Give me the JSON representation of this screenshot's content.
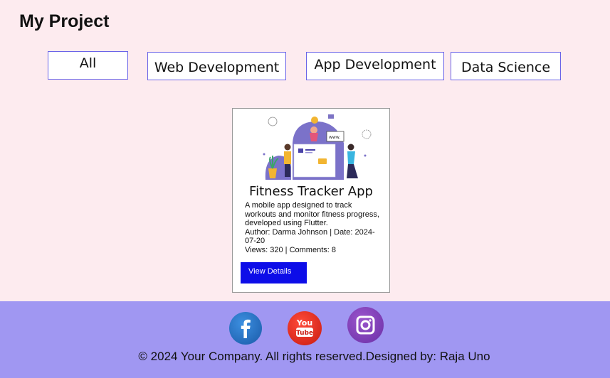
{
  "page": {
    "title": "My Project"
  },
  "filters": [
    {
      "label": "All"
    },
    {
      "label": "Web Development"
    },
    {
      "label": "App Development"
    },
    {
      "label": "Data Science"
    }
  ],
  "card": {
    "image_icon": "fitness-app-illustration",
    "title": "Fitness Tracker App",
    "description": "A mobile app designed to track workouts and monitor fitness progress, developed using Flutter.",
    "meta_author_date": "Author: Darma Johnson | Date: 2024-07-20",
    "meta_views_comments": "Views: 320 | Comments: 8",
    "button_label": "View Details",
    "button_color": "#0d0de8"
  },
  "footer": {
    "background": "#a097f2",
    "social": [
      {
        "icon": "facebook-icon",
        "color": "#1a5aa8"
      },
      {
        "icon": "youtube-icon",
        "color": "#c81a10"
      },
      {
        "icon": "instagram-icon",
        "color": "#6b2fa6"
      }
    ],
    "youtube_label_top": "You",
    "youtube_label_bottom": "Tube",
    "copyright": "© 2024 Your Company. All rights reserved.Designed by: Raja Uno"
  }
}
